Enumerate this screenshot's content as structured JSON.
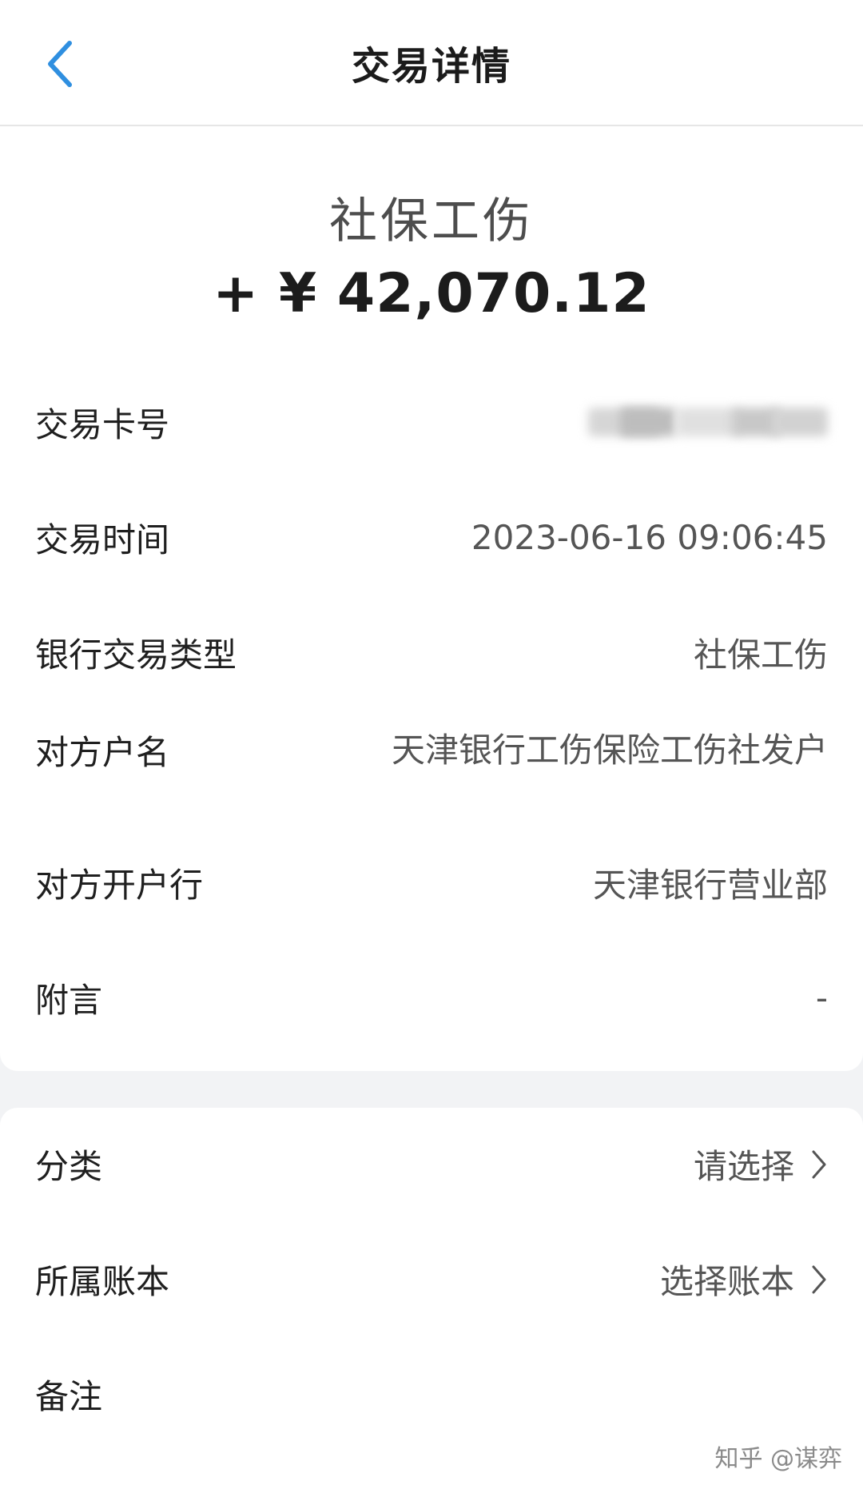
{
  "header": {
    "title": "交易详情"
  },
  "summary": {
    "type": "社保工伤",
    "amount": "+ ¥ 42,070.12"
  },
  "details": {
    "card_no_label": "交易卡号",
    "time_label": "交易时间",
    "time_value": "2023-06-16 09:06:45",
    "bank_type_label": "银行交易类型",
    "bank_type_value": "社保工伤",
    "counterparty_label": "对方户名",
    "counterparty_value": "天津银行工伤保险工伤社发户",
    "counterparty_bank_label": "对方开户行",
    "counterparty_bank_value": "天津银行营业部",
    "remark_label": "附言",
    "remark_value": "-"
  },
  "extra": {
    "category_label": "分类",
    "category_value": "请选择",
    "book_label": "所属账本",
    "book_value": "选择账本",
    "note_label": "备注"
  },
  "watermark": "知乎 @谋弈",
  "colors": {
    "accent": "#2f8fe0",
    "background": "#f2f3f5",
    "card": "#ffffff"
  },
  "icons": {
    "back": "chevron-left-icon",
    "chevron": "chevron-right-icon"
  }
}
